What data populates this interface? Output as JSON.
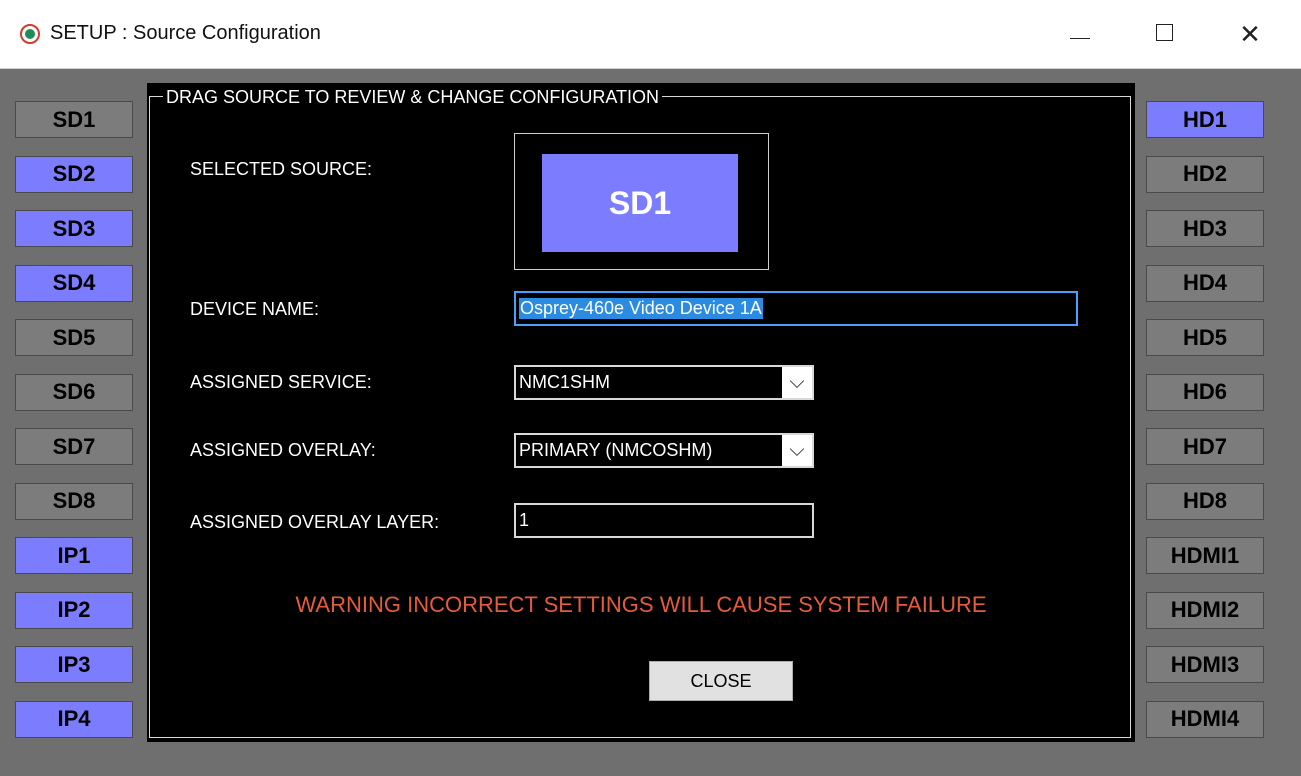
{
  "window": {
    "title": "SETUP : Source Configuration",
    "close_glyph": "✕"
  },
  "left_sources": [
    {
      "label": "SD1",
      "active": false
    },
    {
      "label": "SD2",
      "active": true
    },
    {
      "label": "SD3",
      "active": true
    },
    {
      "label": "SD4",
      "active": true
    },
    {
      "label": "SD5",
      "active": false
    },
    {
      "label": "SD6",
      "active": false
    },
    {
      "label": "SD7",
      "active": false
    },
    {
      "label": "SD8",
      "active": false
    },
    {
      "label": "IP1",
      "active": true
    },
    {
      "label": "IP2",
      "active": true
    },
    {
      "label": "IP3",
      "active": true
    },
    {
      "label": "IP4",
      "active": true
    }
  ],
  "right_sources": [
    {
      "label": "HD1",
      "active": true
    },
    {
      "label": "HD2",
      "active": false
    },
    {
      "label": "HD3",
      "active": false
    },
    {
      "label": "HD4",
      "active": false
    },
    {
      "label": "HD5",
      "active": false
    },
    {
      "label": "HD6",
      "active": false
    },
    {
      "label": "HD7",
      "active": false
    },
    {
      "label": "HD8",
      "active": false
    },
    {
      "label": "HDMI1",
      "active": false
    },
    {
      "label": "HDMI2",
      "active": false
    },
    {
      "label": "HDMI3",
      "active": false
    },
    {
      "label": "HDMI4",
      "active": false
    }
  ],
  "panel": {
    "legend": "DRAG SOURCE TO REVIEW & CHANGE CONFIGURATION",
    "selected_source_label": "SELECTED SOURCE:",
    "selected_source": "SD1",
    "device_name_label": "DEVICE NAME:",
    "device_name_value": "Osprey-460e Video Device 1A",
    "assigned_service_label": "ASSIGNED SERVICE:",
    "assigned_service_value": "NMC1SHM",
    "assigned_overlay_label": "ASSIGNED OVERLAY:",
    "assigned_overlay_value": "PRIMARY (NMCOSHM)",
    "overlay_layer_label": "ASSIGNED OVERLAY LAYER:",
    "overlay_layer_value": "1",
    "warning": "WARNING INCORRECT SETTINGS WILL CAUSE SYSTEM FAILURE",
    "close_label": "CLOSE",
    "dropdown_glyph": "⌵"
  },
  "colors": {
    "active_source": "#7c7cff",
    "inactive_source": "#7c7c7c",
    "warning": "#e55b3c"
  }
}
